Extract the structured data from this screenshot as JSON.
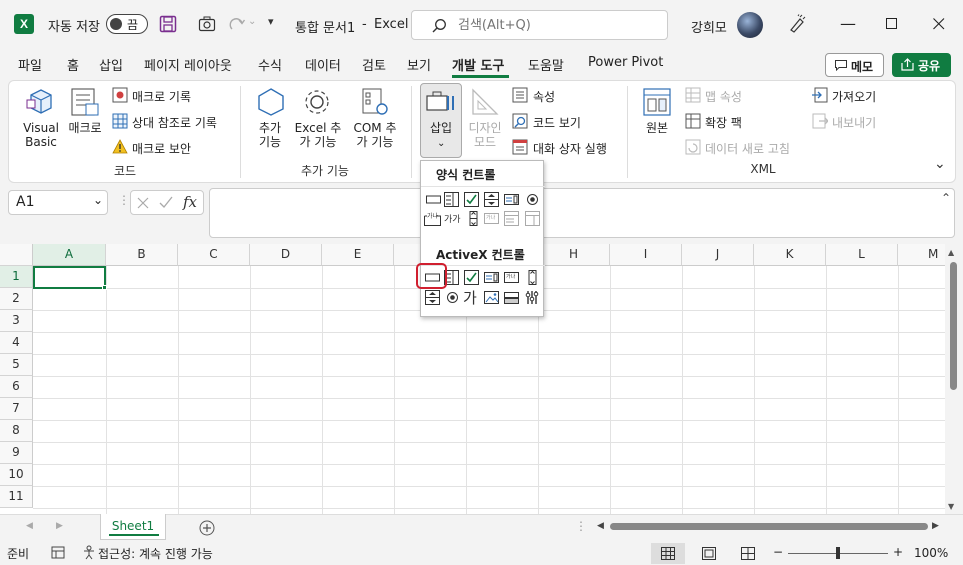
{
  "title_bar": {
    "autosave_label": "자동 저장",
    "autosave_state": "끔",
    "doc_title": "통합 문서1",
    "app_separator": "-",
    "app_name": "Excel",
    "search_placeholder": "검색(Alt+Q)",
    "user_name": "강희모"
  },
  "menu_tabs": [
    "파일",
    "홈",
    "삽입",
    "페이지 레이아웃",
    "수식",
    "데이터",
    "검토",
    "보기",
    "개발 도구",
    "도움말",
    "Power Pivot"
  ],
  "active_tab": "개발 도구",
  "buttons": {
    "memo": "메모",
    "share": "공유"
  },
  "ribbon": {
    "code": {
      "visual_basic": "Visual Basic",
      "macro": "매크로",
      "record_macro": "매크로 기록",
      "relative_ref": "상대 참조로 기록",
      "macro_security": "매크로 보안",
      "group_label": "코드"
    },
    "addins": {
      "addins": "추가 기능",
      "excel_addins": "Excel 추가 기능",
      "com_addins": "COM 추가 기능",
      "group_label": "추가 기능"
    },
    "controls": {
      "insert": "삽입",
      "design_mode": "디자인 모드",
      "properties": "속성",
      "view_code": "코드 보기",
      "run_dialog": "대화 상자 실행"
    },
    "xml": {
      "source": "원본",
      "map_properties": "맵 속성",
      "expansion_packs": "확장 팩",
      "refresh_data": "데이터 새로 고침",
      "import": "가져오기",
      "export": "내보내기",
      "group_label": "XML"
    }
  },
  "dropdown": {
    "form_controls_title": "양식 컨트롤",
    "activex_title": "ActiveX 컨트롤",
    "form_label_glyph": "가가",
    "activex_label_glyph": "가"
  },
  "formula_bar": {
    "name_box": "A1",
    "fx": "fx",
    "value": ""
  },
  "grid": {
    "columns": [
      "A",
      "B",
      "C",
      "D",
      "E",
      "F",
      "G",
      "H",
      "I",
      "J",
      "K",
      "L",
      "M"
    ],
    "rows": [
      "1",
      "2",
      "3",
      "4",
      "5",
      "6",
      "7",
      "8",
      "9",
      "10",
      "11"
    ],
    "selected_cell": "A1"
  },
  "sheets": [
    "Sheet1"
  ],
  "status_bar": {
    "ready": "준비",
    "accessibility": "접근성: 계속 진행 가능",
    "zoom": "100%"
  },
  "colors": {
    "accent": "#107c41",
    "highlight": "#d01f2f"
  }
}
